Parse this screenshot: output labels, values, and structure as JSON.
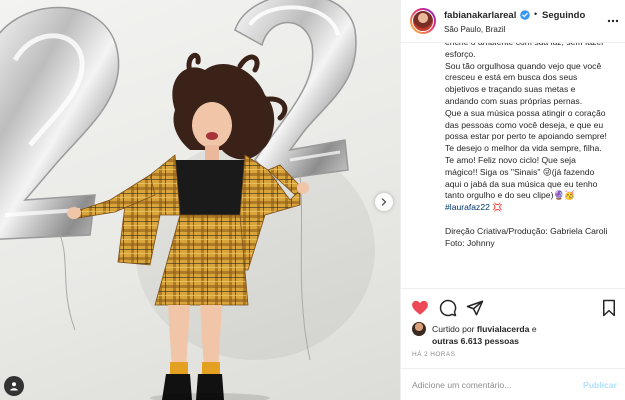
{
  "post": {
    "username": "fabianakarlareal",
    "follow_status": "Seguindo",
    "dot": "•",
    "location": "São Paulo, Brazil"
  },
  "caption": {
    "lines": [
      "enche o ambiente com sua luz, sem fazer esforço.",
      "Sou tão orgulhosa quando vejo que você cresceu e está em busca dos seus objetivos e traçando suas metas e andando com suas próprias pernas.",
      "Que a sua música possa atingir o coração das pessoas como você deseja, e que eu possa estar por perto te apoiando sempre!",
      "Te desejo o melhor da vida sempre, filha. Te amo! Feliz novo ciclo! Que seja mágico!! Siga os \"Sinais\" 😜(já fazendo aqui o jabá da sua música que eu tenho tanto orgulho e do seu clipe)🔮🥳"
    ],
    "hashtag": "#laurafaz22",
    "hashtag_emoji": " 💢",
    "credits_1": "Direção Criativa/Produção: Gabriela Caroli",
    "credits_2": "Foto: Johnny"
  },
  "likes": {
    "prefix": "Curtido por ",
    "user": "fluvialacerda",
    "middle": " e",
    "others": "outras 6.613 pessoas"
  },
  "timestamp": "HÁ 2 HORAS",
  "comment": {
    "placeholder": "Adicione um comentário...",
    "publish_label": "Publicar"
  },
  "photo_balloon_text": "22",
  "icons": {
    "like": "heart-icon",
    "comment": "comment-icon",
    "share": "share-icon",
    "save": "bookmark-icon",
    "more": "more-options-icon",
    "next": "chevron-right-icon",
    "tag": "user-tag-icon",
    "verified": "verified-badge-icon"
  },
  "colors": {
    "like_red": "#ed4956",
    "verified_blue": "#3897f0",
    "hashtag": "#00376b",
    "publish_disabled": "#b2dffc",
    "plaid_mustard": "#d9a53a"
  }
}
